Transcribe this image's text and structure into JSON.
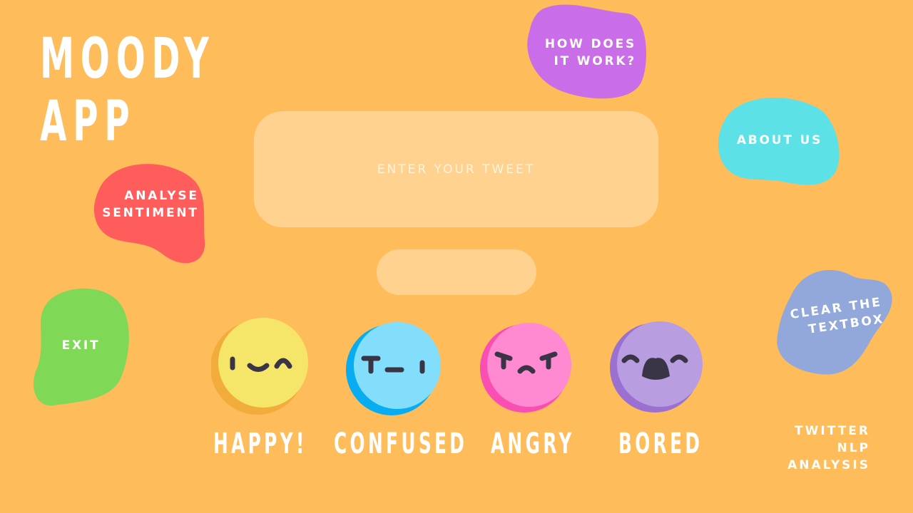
{
  "app": {
    "title_line1": "MOODY",
    "title_line2": "APP"
  },
  "nav": {
    "how_it_works": [
      "HOW DOES",
      "IT WORK?"
    ],
    "about_us": "ABOUT US",
    "analyse": [
      "ANALYSE",
      "SENTIMENT"
    ],
    "exit": "EXIT",
    "clear": [
      "CLEAR THE",
      "TEXTBOX"
    ]
  },
  "input": {
    "placeholder": "ENTER YOUR TWEET",
    "value": ""
  },
  "result": {
    "value": ""
  },
  "moods": [
    {
      "label": "HAPPY!",
      "face": "happy-face-icon",
      "color": "#F5E66A",
      "shade": "#F2AC3C"
    },
    {
      "label": "CONFUSED",
      "face": "confused-face-icon",
      "color": "#82DEFA",
      "shade": "#08ACF0"
    },
    {
      "label": "ANGRY",
      "face": "angry-face-icon",
      "color": "#FF8AD2",
      "shade": "#F94FB2"
    },
    {
      "label": "BORED",
      "face": "bored-face-icon",
      "color": "#B89DE0",
      "shade": "#9A71D0"
    }
  ],
  "footer": [
    "TWITTER",
    "NLP",
    "ANALYSIS"
  ],
  "colors": {
    "background": "#FFBC5B",
    "panel": "#FFD28F",
    "how_blob": "#C96DE8",
    "about_blob": "#5CE2E6",
    "analyse_blob": "#FF5C5C",
    "exit_blob": "#7FD957",
    "clear_blob": "#92A8DA"
  }
}
